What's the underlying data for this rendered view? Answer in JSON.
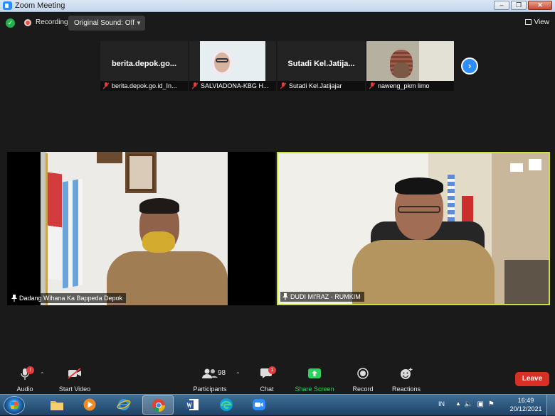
{
  "window": {
    "title": "Zoom Meeting",
    "controls": [
      "minimize-icon",
      "restore-icon",
      "close-icon"
    ]
  },
  "topbar": {
    "recording_label": "Recording",
    "sound_label": "Original Sound: Off",
    "view_label": "View"
  },
  "thumbnails": [
    {
      "display_text": "berita.depok.go...",
      "name": "berita.depok.go.id_In...",
      "muted": true
    },
    {
      "display_text": "",
      "name": "SALVIADONA-KBG H...",
      "muted": true
    },
    {
      "display_text": "Sutadi  Kel.Jatija...",
      "name": "Sutadi Kel.Jatijajar",
      "muted": true
    },
    {
      "display_text": "",
      "name": "naweng_pkm limo",
      "muted": true
    }
  ],
  "videos": [
    {
      "name": "Dadang Wihana Ka Bappeda Depok"
    },
    {
      "name": "DUDI MI'RAZ - RUMKIM",
      "active_speaker": true
    }
  ],
  "toolbar": {
    "audio_label": "Audio",
    "audio_badge": "!",
    "video_label": "Start Video",
    "participants_label": "Participants",
    "participants_count": "98",
    "chat_label": "Chat",
    "chat_badge": "1",
    "share_label": "Share Screen",
    "record_label": "Record",
    "reactions_label": "Reactions",
    "leave_label": "Leave"
  },
  "taskbar": {
    "language": "IN",
    "time": "16:49",
    "date": "20/12/2021",
    "apps": [
      "file-explorer-icon",
      "media-player-icon",
      "internet-explorer-icon",
      "chrome-icon",
      "word-icon",
      "edge-icon",
      "zoom-icon"
    ]
  },
  "colors": {
    "zoom_blue": "#2d8cff",
    "active_speaker_border": "#c7df3f",
    "leave_red": "#d93025",
    "share_green": "#2fd15e",
    "background": "#1a1a1a"
  }
}
